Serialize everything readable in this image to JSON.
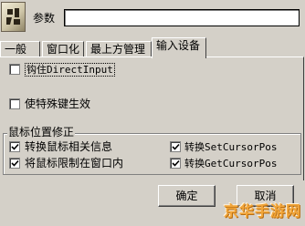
{
  "param": {
    "label": "参数",
    "value": ""
  },
  "tabs": [
    {
      "label": "一般"
    },
    {
      "label": "窗口化"
    },
    {
      "label": "最上方管理"
    },
    {
      "label": "输入设备"
    }
  ],
  "options": {
    "direct_input": {
      "label": "钩住DirectInput",
      "checked": false
    },
    "special_keys": {
      "label": "使特殊键生效",
      "checked": false
    }
  },
  "mouse_group": {
    "title": "鼠标位置修正",
    "items": [
      {
        "label": "转换鼠标相关信息",
        "checked": true
      },
      {
        "label": "将鼠标限制在窗口内",
        "checked": true
      },
      {
        "label": "转换SetCursorPos",
        "checked": true
      },
      {
        "label": "转换GetCursorPos",
        "checked": true
      }
    ]
  },
  "buttons": {
    "ok": "确定",
    "cancel": "取消"
  },
  "watermark": "京华手游网",
  "colors": {
    "face": "#d4d0c8",
    "watermark": "#f2a63a"
  }
}
